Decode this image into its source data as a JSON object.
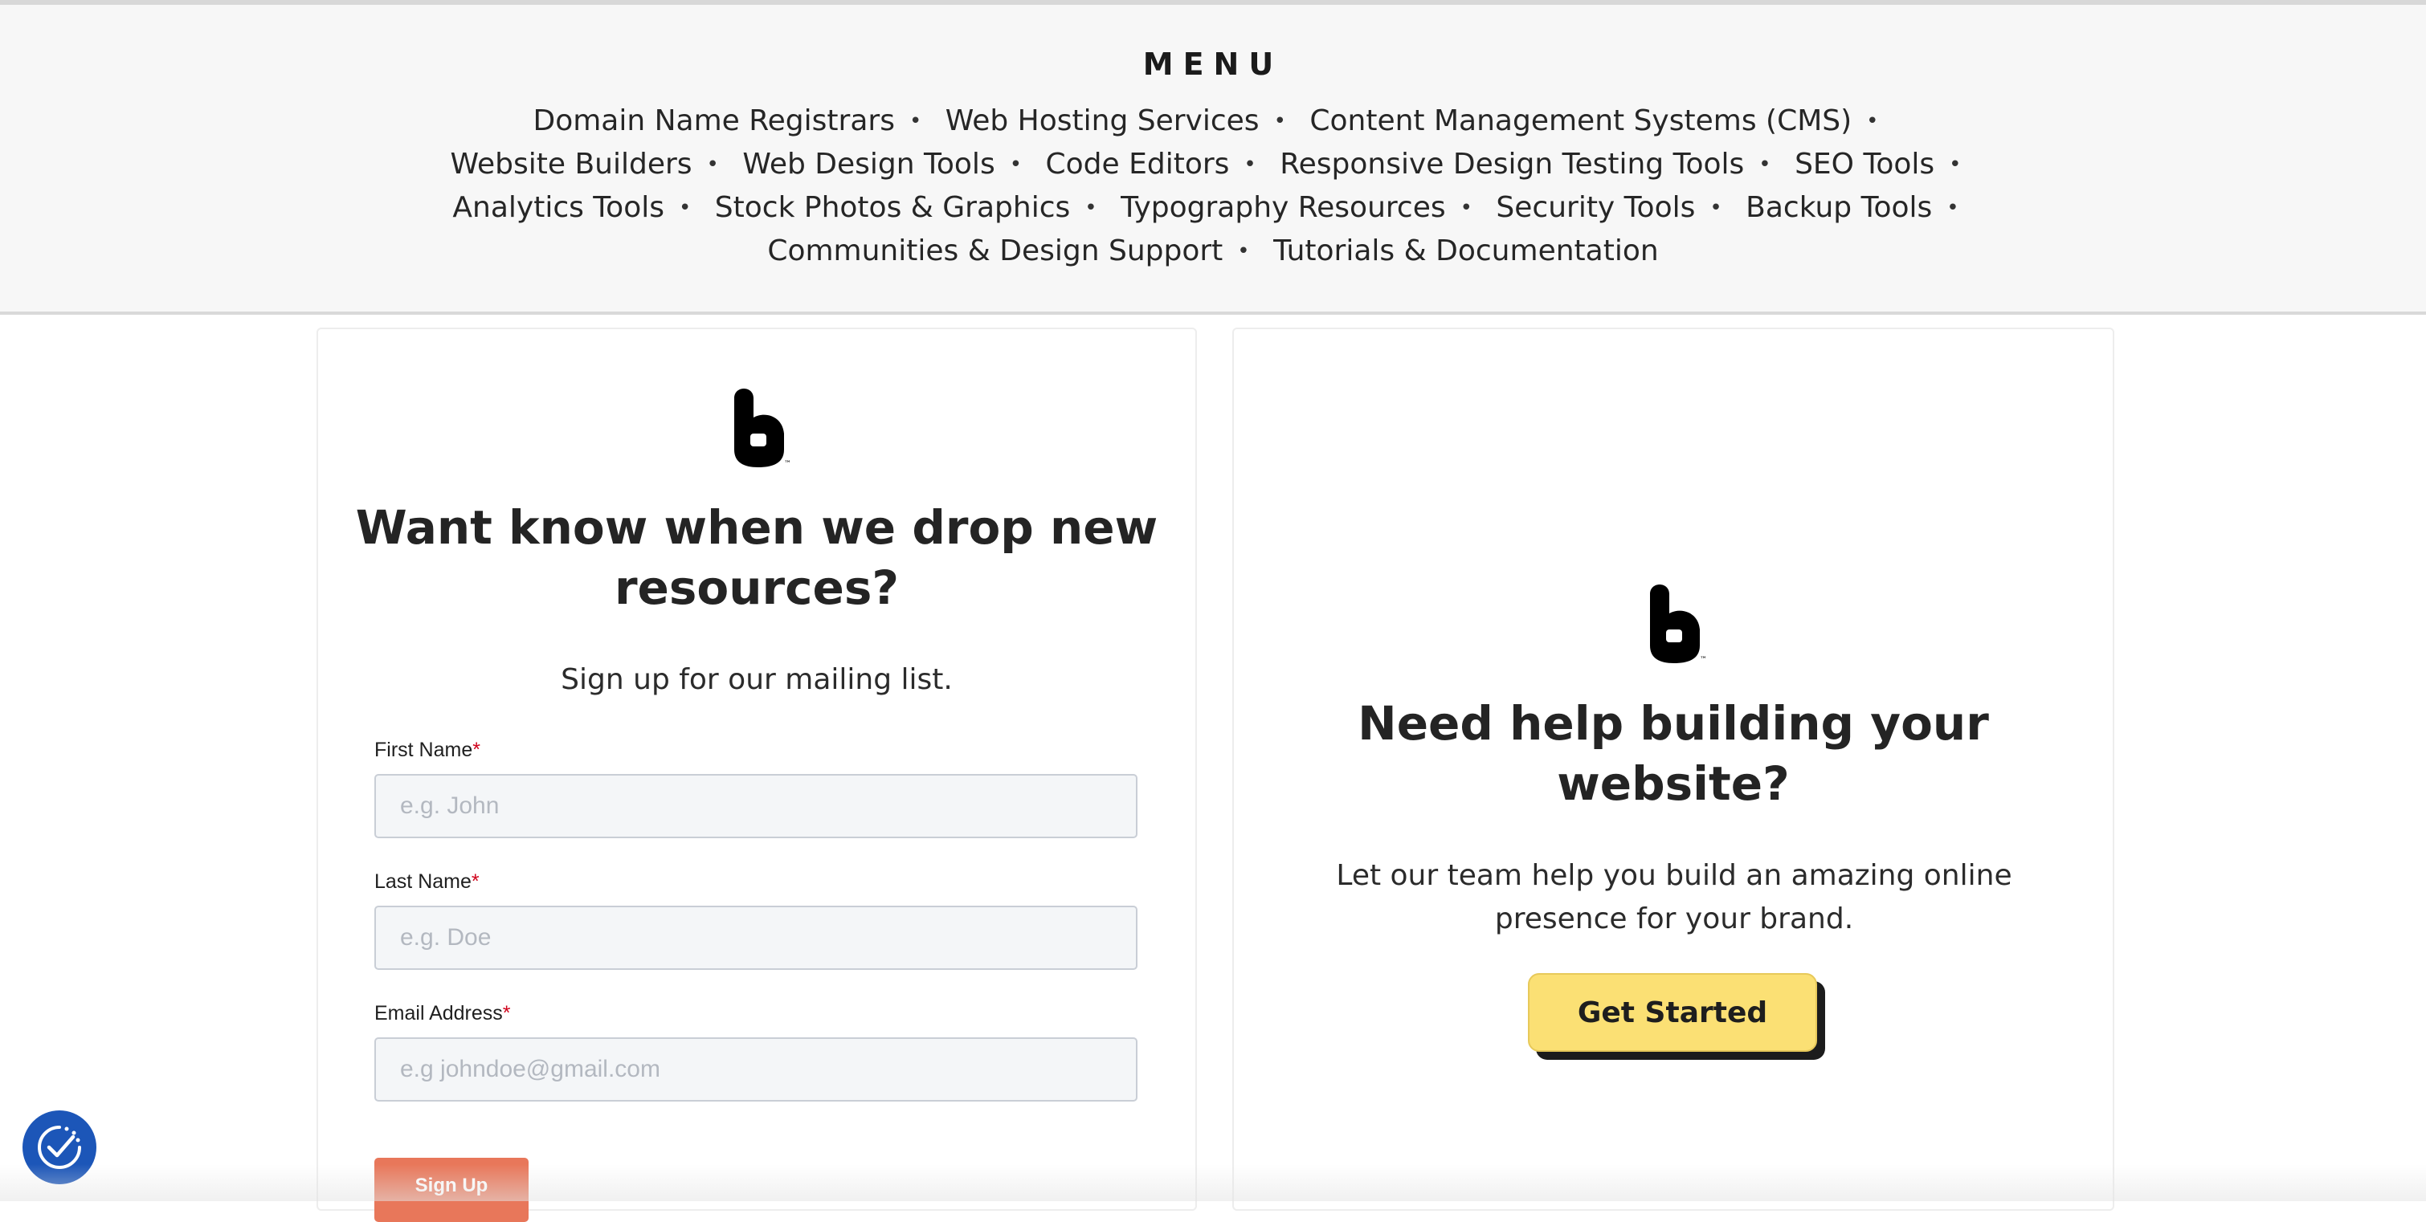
{
  "menu": {
    "title": "MENU",
    "items": [
      "Domain Name Registrars",
      "Web Hosting Services",
      "Content Management Systems (CMS)",
      "Website Builders",
      "Web Design Tools",
      "Code Editors",
      "Responsive Design Testing Tools",
      "SEO Tools",
      "Analytics Tools",
      "Stock Photos & Graphics",
      "Typography Resources",
      "Security Tools",
      "Backup Tools",
      "Communities & Design Support",
      "Tutorials & Documentation"
    ],
    "separator": "•"
  },
  "newsletter": {
    "heading": "Want know when we drop new resources?",
    "subtext": "Sign up for our mailing list.",
    "required_mark": "*",
    "fields": [
      {
        "label": "First Name",
        "placeholder": "e.g. John",
        "value": ""
      },
      {
        "label": "Last Name",
        "placeholder": "e.g. Doe",
        "value": ""
      },
      {
        "label": "Email Address",
        "placeholder": "e.g johndoe@gmail.com",
        "value": ""
      }
    ],
    "submit_label": "Sign Up"
  },
  "help_card": {
    "heading": "Need help building your website?",
    "subtext": "Let our team help you build an amazing online presence for your brand.",
    "cta_label": "Get Started"
  },
  "icons": {
    "brand_logo": "brand-logo-icon",
    "accessibility": "accessibility-icon"
  },
  "colors": {
    "menu_background": "#f7f7f7",
    "signup_button": "#e8775a",
    "cta_button": "#fbe074",
    "accessibility_button": "#1c56b8",
    "required_asterisk": "#d0021b"
  }
}
